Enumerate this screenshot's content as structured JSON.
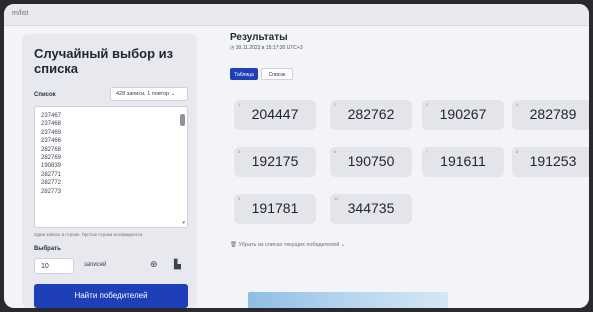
{
  "browser": {
    "url": "m/list"
  },
  "left_panel": {
    "title": "Случайный выбор из списка",
    "list_label": "Список",
    "list_select": "428 записи, 1 повтор",
    "items": [
      "237467",
      "237468",
      "237469",
      "237466",
      "282768",
      "282769",
      "190839",
      "282771",
      "282772",
      "282773"
    ],
    "hint": "Одна запись в строке. Пустые строки игнорируются.",
    "pick_label": "Выбрать",
    "pick_count": "10",
    "pick_unit": "записей",
    "find_button": "Найти победителей"
  },
  "results": {
    "title": "Результаты",
    "timestamp": "30.11.2023 в 15:17:30 UTC+3",
    "tabs": [
      "Таблица",
      "Список"
    ],
    "winners": [
      {
        "idx": "1",
        "value": "204447"
      },
      {
        "idx": "2",
        "value": "282762"
      },
      {
        "idx": "3",
        "value": "190267"
      },
      {
        "idx": "4",
        "value": "282789"
      },
      {
        "idx": "5",
        "value": "192175"
      },
      {
        "idx": "6",
        "value": "190750"
      },
      {
        "idx": "7",
        "value": "191611"
      },
      {
        "idx": "8",
        "value": "191253"
      },
      {
        "idx": "9",
        "value": "191781"
      },
      {
        "idx": "10",
        "value": "344735"
      }
    ],
    "remove_text": "Убрать из списка текущих победителей"
  },
  "icons": {
    "refresh": "refresh-icon",
    "copy": "copy-icon",
    "trash": "trash-icon",
    "chevron": "chevron-down-icon"
  }
}
